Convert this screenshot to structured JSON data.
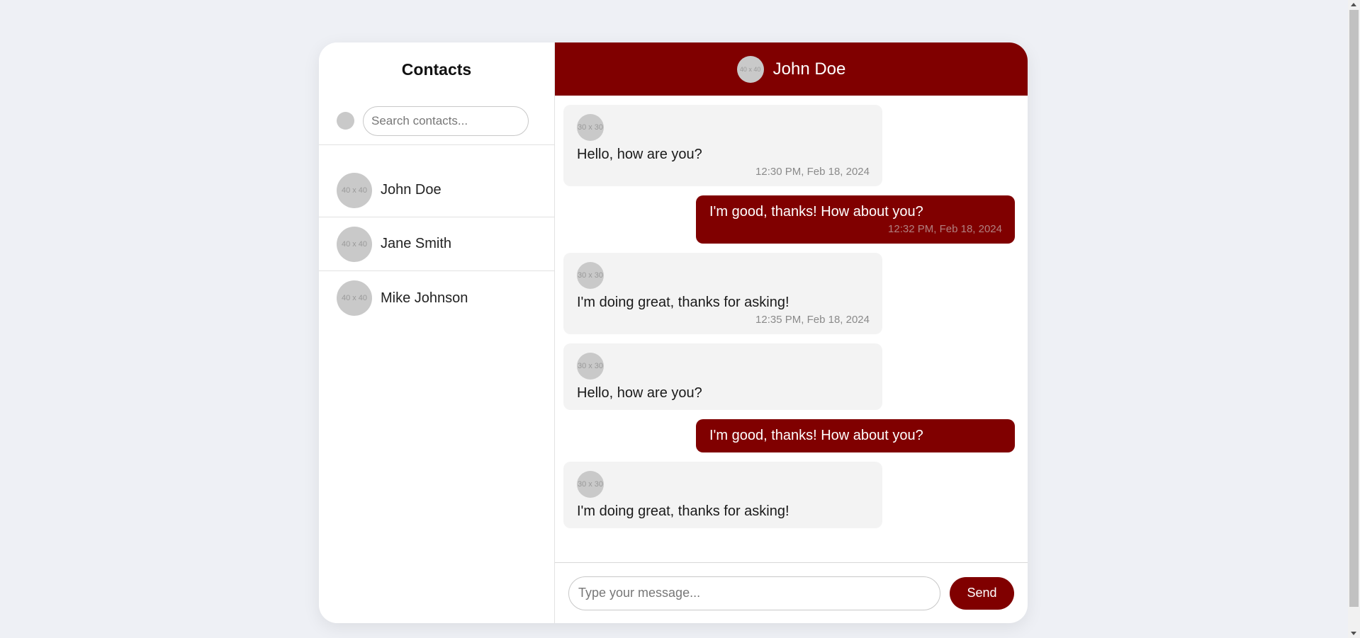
{
  "sidebar": {
    "title": "Contacts",
    "search": {
      "placeholder": "Search contacts...",
      "value": ""
    },
    "contacts": [
      {
        "name": "John Doe",
        "avatar": "40 x 40"
      },
      {
        "name": "Jane Smith",
        "avatar": "40 x 40"
      },
      {
        "name": "Mike Johnson",
        "avatar": "40 x 40"
      }
    ]
  },
  "chat": {
    "header": {
      "title": "John Doe",
      "avatar": "40 x 40"
    },
    "messages": [
      {
        "direction": "in",
        "avatar": "30 x 30",
        "text": "Hello, how are you?",
        "time": "12:30 PM, Feb 18, 2024"
      },
      {
        "direction": "out",
        "text": "I'm good, thanks! How about you?",
        "time": "12:32 PM, Feb 18, 2024"
      },
      {
        "direction": "in",
        "avatar": "30 x 30",
        "text": "I'm doing great, thanks for asking!",
        "time": "12:35 PM, Feb 18, 2024"
      },
      {
        "direction": "in",
        "avatar": "30 x 30",
        "text": "Hello, how are you?"
      },
      {
        "direction": "out",
        "text": "I'm good, thanks! How about you?"
      },
      {
        "direction": "in",
        "avatar": "30 x 30",
        "text": "I'm doing great, thanks for asking!"
      }
    ],
    "composer": {
      "placeholder": "Type your message...",
      "value": "",
      "send_label": "Send"
    }
  },
  "colors": {
    "accent": "#800000",
    "background": "#eef0f5",
    "incoming_bubble": "#f3f3f3",
    "avatar_placeholder": "#c9c9c9"
  },
  "icons": {
    "search_indicator": "search-dot-icon"
  }
}
